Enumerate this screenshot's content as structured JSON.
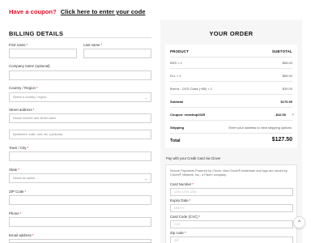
{
  "coupon": {
    "question": "Have a coupon?",
    "link": "Click here to enter your code"
  },
  "billing": {
    "title": "BILLING DETAILS",
    "first_name": "First name",
    "last_name": "Last name",
    "company": "Company name (optional)",
    "country": "Country / Region",
    "country_placeholder": "Select a country / region...",
    "street": "Street address",
    "street_placeholder1": "House number and street name",
    "street_placeholder2": "Apartment, suite, unit, etc. (optional)",
    "town": "Town / City",
    "state": "State",
    "state_placeholder": "Select an option...",
    "zip": "ZIP Code",
    "phone": "Phone",
    "email": "Email address",
    "required_mark": "*"
  },
  "order": {
    "title": "YOUR ORDER",
    "col_product": "PRODUCT",
    "col_subtotal": "SUBTOTAL",
    "items": [
      {
        "name": "BDS × 1",
        "price": "$68.00"
      },
      {
        "name": "ELL × 1",
        "price": "$68.00"
      },
      {
        "name": "Brems - DVD Class (+$5) × 1",
        "price": "$39.00"
      }
    ],
    "subtotal_label": "Subtotal",
    "subtotal_value": "$176.50",
    "coupon_label": "Coupon: newdrop2025",
    "coupon_value": "-$42.50",
    "coupon_remove": "×",
    "shipping_label": "Shipping",
    "shipping_value": "Enter your address to view shipping options.",
    "total_label": "Total",
    "total_value": "$127.50"
  },
  "payment": {
    "method_label": "Pay with your Credit Card via Clover",
    "description": "Secure Payments Powered by Clover. Visa Clover® trademark and logo are owned by Clover® Network, Inc., a Fiserv company.",
    "card_number": "Card Number",
    "card_number_placeholder": "1234 1234 1234",
    "expiry": "Expiry Date",
    "expiry_placeholder": "MM/YY",
    "cvc": "Card Code (CVC)",
    "cvc_placeholder": "CVC",
    "zip": "Zip code",
    "zip_placeholder": "ZIP"
  },
  "scroll_top_icon": "^",
  "colors": {
    "accent_red": "#e0102a",
    "panel_bg": "#f6f6f6"
  }
}
